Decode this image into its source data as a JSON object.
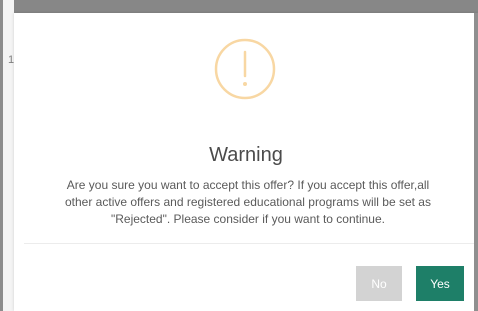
{
  "background": {
    "fragment": "1"
  },
  "dialog": {
    "icon": "exclamation-circle-icon",
    "title": "Warning",
    "message_lines": [
      "Are you sure you want to accept this offer? If you accept this offer,all",
      "other active offers and registered educational programs will be set as",
      "\"Rejected\". Please consider if you want to continue."
    ],
    "buttons": {
      "no": "No",
      "yes": "Yes"
    }
  },
  "colors": {
    "warning_accent": "#f8d7a3",
    "confirm_button": "#1e7f68",
    "cancel_button": "#d3d3d3",
    "overlay": "#878787"
  }
}
